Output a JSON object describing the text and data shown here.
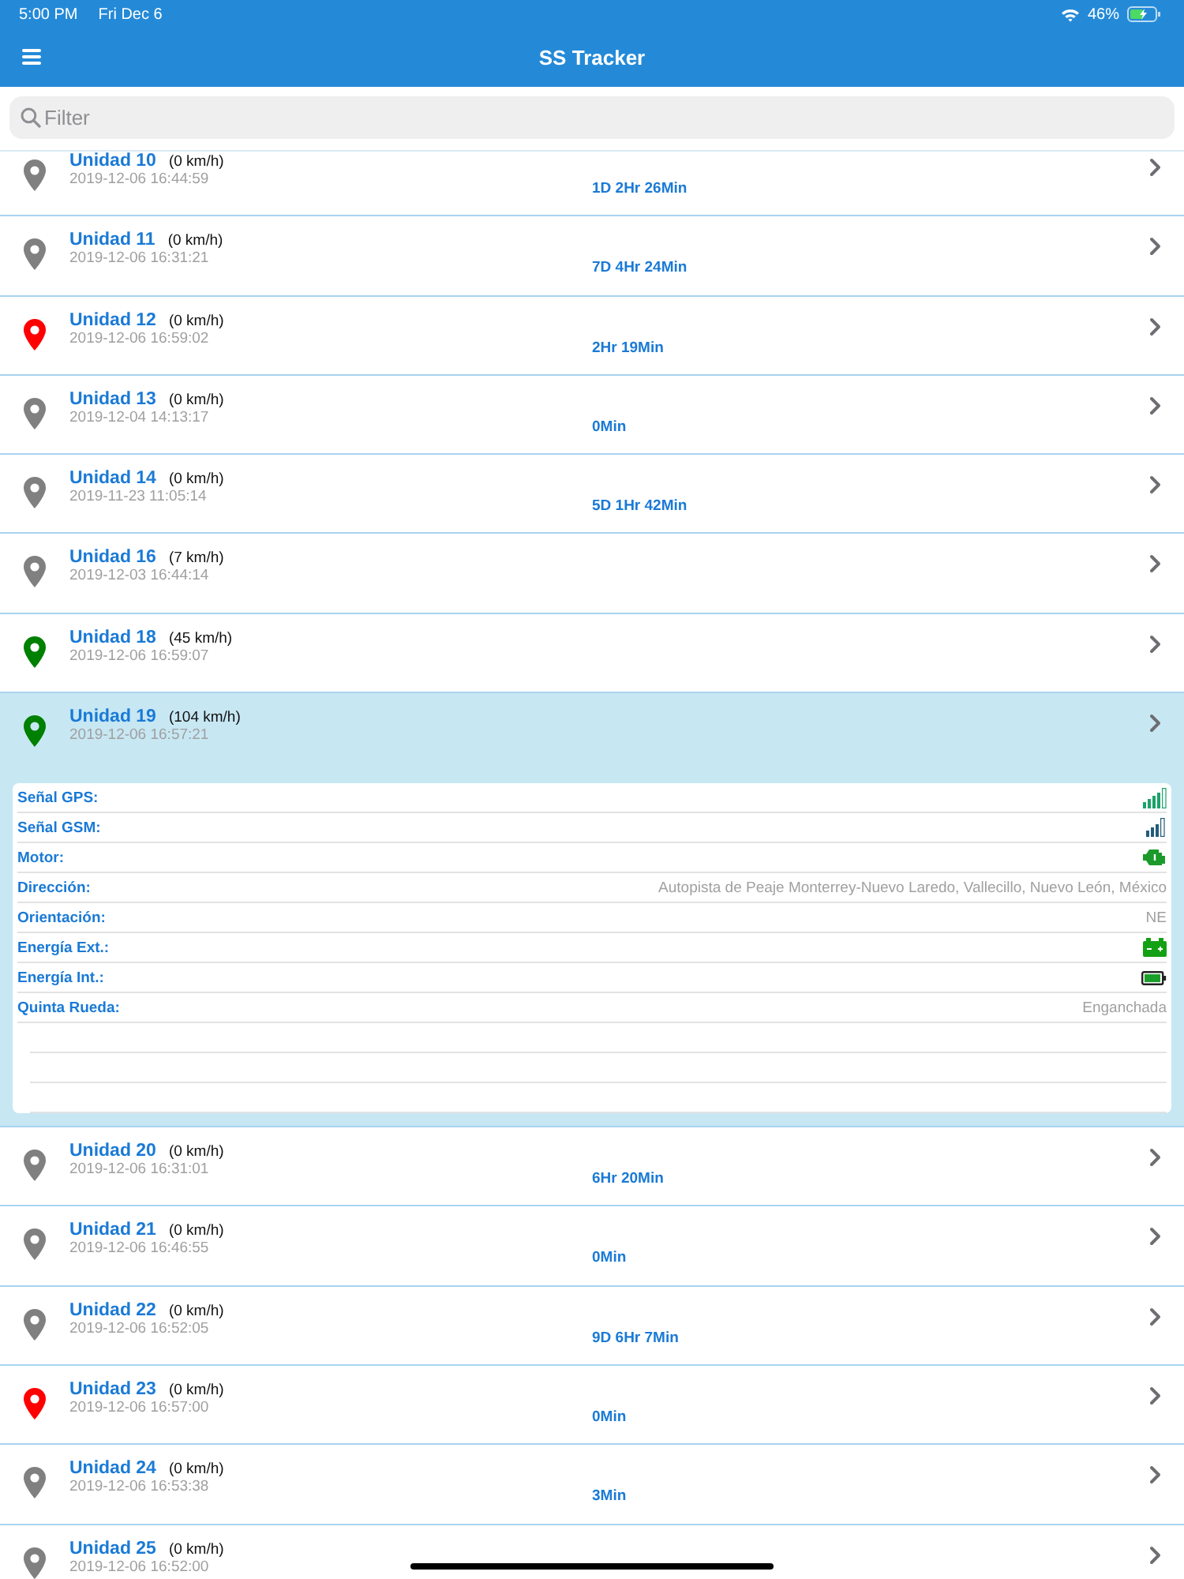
{
  "status_bar": {
    "time": "5:00 PM",
    "date": "Fri Dec 6",
    "battery": "46%"
  },
  "nav": {
    "title": "SS Tracker"
  },
  "search": {
    "placeholder": "Filter"
  },
  "units": [
    {
      "name": "Unidad 10",
      "speed": "(0 km/h)",
      "timestamp": "2019-12-06 16:44:59",
      "duration": "1D 2Hr 26Min",
      "color": "#808080",
      "expanded": false
    },
    {
      "name": "Unidad 11",
      "speed": "(0 km/h)",
      "timestamp": "2019-12-06 16:31:21",
      "duration": "7D 4Hr 24Min",
      "color": "#808080",
      "expanded": false
    },
    {
      "name": "Unidad 12",
      "speed": "(0 km/h)",
      "timestamp": "2019-12-06 16:59:02",
      "duration": "2Hr 19Min",
      "color": "#ff0000",
      "expanded": false
    },
    {
      "name": "Unidad 13",
      "speed": "(0 km/h)",
      "timestamp": "2019-12-04 14:13:17",
      "duration": "0Min",
      "color": "#808080",
      "expanded": false
    },
    {
      "name": "Unidad 14",
      "speed": "(0 km/h)",
      "timestamp": "2019-11-23 11:05:14",
      "duration": "5D 1Hr 42Min",
      "color": "#808080",
      "expanded": false
    },
    {
      "name": "Unidad 16",
      "speed": "(7 km/h)",
      "timestamp": "2019-12-03 16:44:14",
      "color": "#808080",
      "expanded": false
    },
    {
      "name": "Unidad 18",
      "speed": "(45 km/h)",
      "timestamp": "2019-12-06 16:59:07",
      "color": "#008000",
      "expanded": false
    },
    {
      "name": "Unidad 19",
      "speed": "(104 km/h)",
      "timestamp": "2019-12-06 16:57:21",
      "color": "#008000",
      "expanded": true,
      "details": [
        {
          "label": "Señal GPS:",
          "kind": "gps-signal"
        },
        {
          "label": "Señal GSM:",
          "kind": "gsm-signal"
        },
        {
          "label": "Motor:",
          "kind": "engine"
        },
        {
          "label": "Dirección:",
          "kind": "text",
          "value": "Autopista de Peaje Monterrey-Nuevo Laredo, Vallecillo, Nuevo León, México"
        },
        {
          "label": "Orientación:",
          "kind": "text",
          "value": "NE"
        },
        {
          "label": "Energía Ext.:",
          "kind": "external-battery"
        },
        {
          "label": "Energía Int.:",
          "kind": "battery"
        },
        {
          "label": "Quinta Rueda:",
          "kind": "text",
          "value": "Enganchada"
        }
      ]
    },
    {
      "name": "Unidad 20",
      "speed": "(0 km/h)",
      "timestamp": "2019-12-06 16:31:01",
      "duration": "6Hr 20Min",
      "color": "#808080",
      "expanded": false
    },
    {
      "name": "Unidad 21",
      "speed": "(0 km/h)",
      "timestamp": "2019-12-06 16:46:55",
      "duration": "0Min",
      "color": "#808080",
      "expanded": false
    },
    {
      "name": "Unidad 22",
      "speed": "(0 km/h)",
      "timestamp": "2019-12-06 16:52:05",
      "duration": "9D 6Hr 7Min",
      "color": "#808080",
      "expanded": false
    },
    {
      "name": "Unidad 23",
      "speed": "(0 km/h)",
      "timestamp": "2019-12-06 16:57:00",
      "duration": "0Min",
      "color": "#ff0000",
      "expanded": false
    },
    {
      "name": "Unidad 24",
      "speed": "(0 km/h)",
      "timestamp": "2019-12-06 16:53:38",
      "duration": "3Min",
      "color": "#808080",
      "expanded": false
    },
    {
      "name": "Unidad 25",
      "speed": "(0 km/h)",
      "timestamp": "2019-12-06 16:52:00",
      "color": "#808080",
      "expanded": false
    }
  ]
}
